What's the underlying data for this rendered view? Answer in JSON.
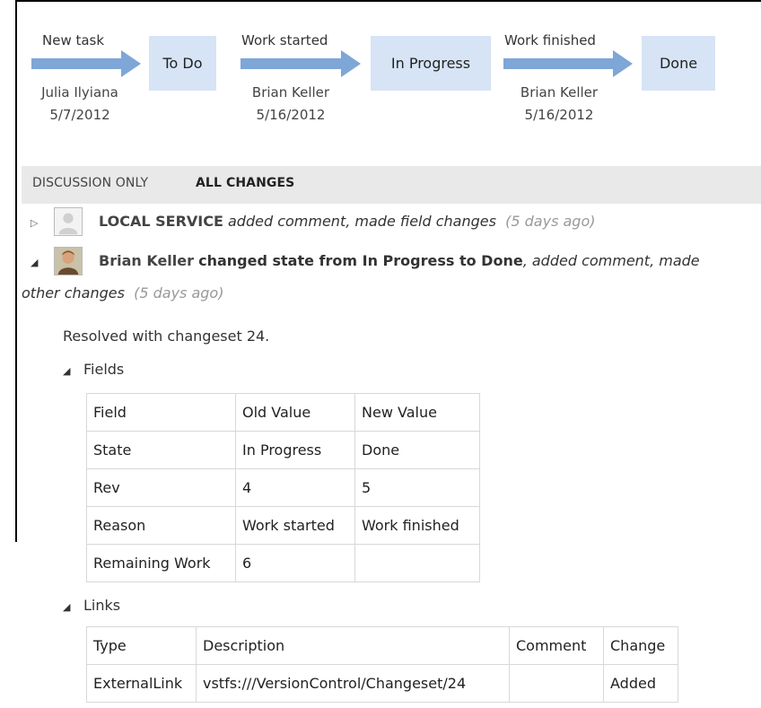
{
  "workflow": {
    "transitions": [
      {
        "label": "New task",
        "user": "Julia Ilyiana",
        "date": "5/7/2012"
      },
      {
        "label": "Work started",
        "user": "Brian Keller",
        "date": "5/16/2012"
      },
      {
        "label": "Work finished",
        "user": "Brian Keller",
        "date": "5/16/2012"
      }
    ],
    "states": [
      "To Do",
      "In Progress",
      "Done"
    ],
    "colors": {
      "arrow": "#7ea6d6",
      "state_box": "#d6e4f5"
    }
  },
  "history": {
    "tabs": {
      "discussion": "DISCUSSION ONLY",
      "all": "ALL CHANGES"
    },
    "entry1": {
      "user": "LOCAL SERVICE",
      "summary": "added comment, made field changes",
      "when": "(5 days ago)"
    },
    "entry2": {
      "user": "Brian Keller",
      "change": "changed state from In Progress to Done",
      "summary_a": ", added comment, made",
      "summary_b": "other changes",
      "when": "(5 days ago)",
      "comment": "Resolved with changeset 24."
    },
    "fields": {
      "title": "Fields",
      "header": [
        "Field",
        "Old Value",
        "New Value"
      ],
      "rows": [
        [
          "State",
          "In Progress",
          "Done"
        ],
        [
          "Rev",
          "4",
          "5"
        ],
        [
          "Reason",
          "Work started",
          "Work finished"
        ],
        [
          "Remaining Work",
          "6",
          ""
        ]
      ]
    },
    "links": {
      "title": "Links",
      "header": [
        "Type",
        "Description",
        "Comment",
        "Change"
      ],
      "rows": [
        [
          "ExternalLink",
          "vstfs:///VersionControl/Changeset/24",
          "",
          "Added"
        ]
      ]
    }
  }
}
